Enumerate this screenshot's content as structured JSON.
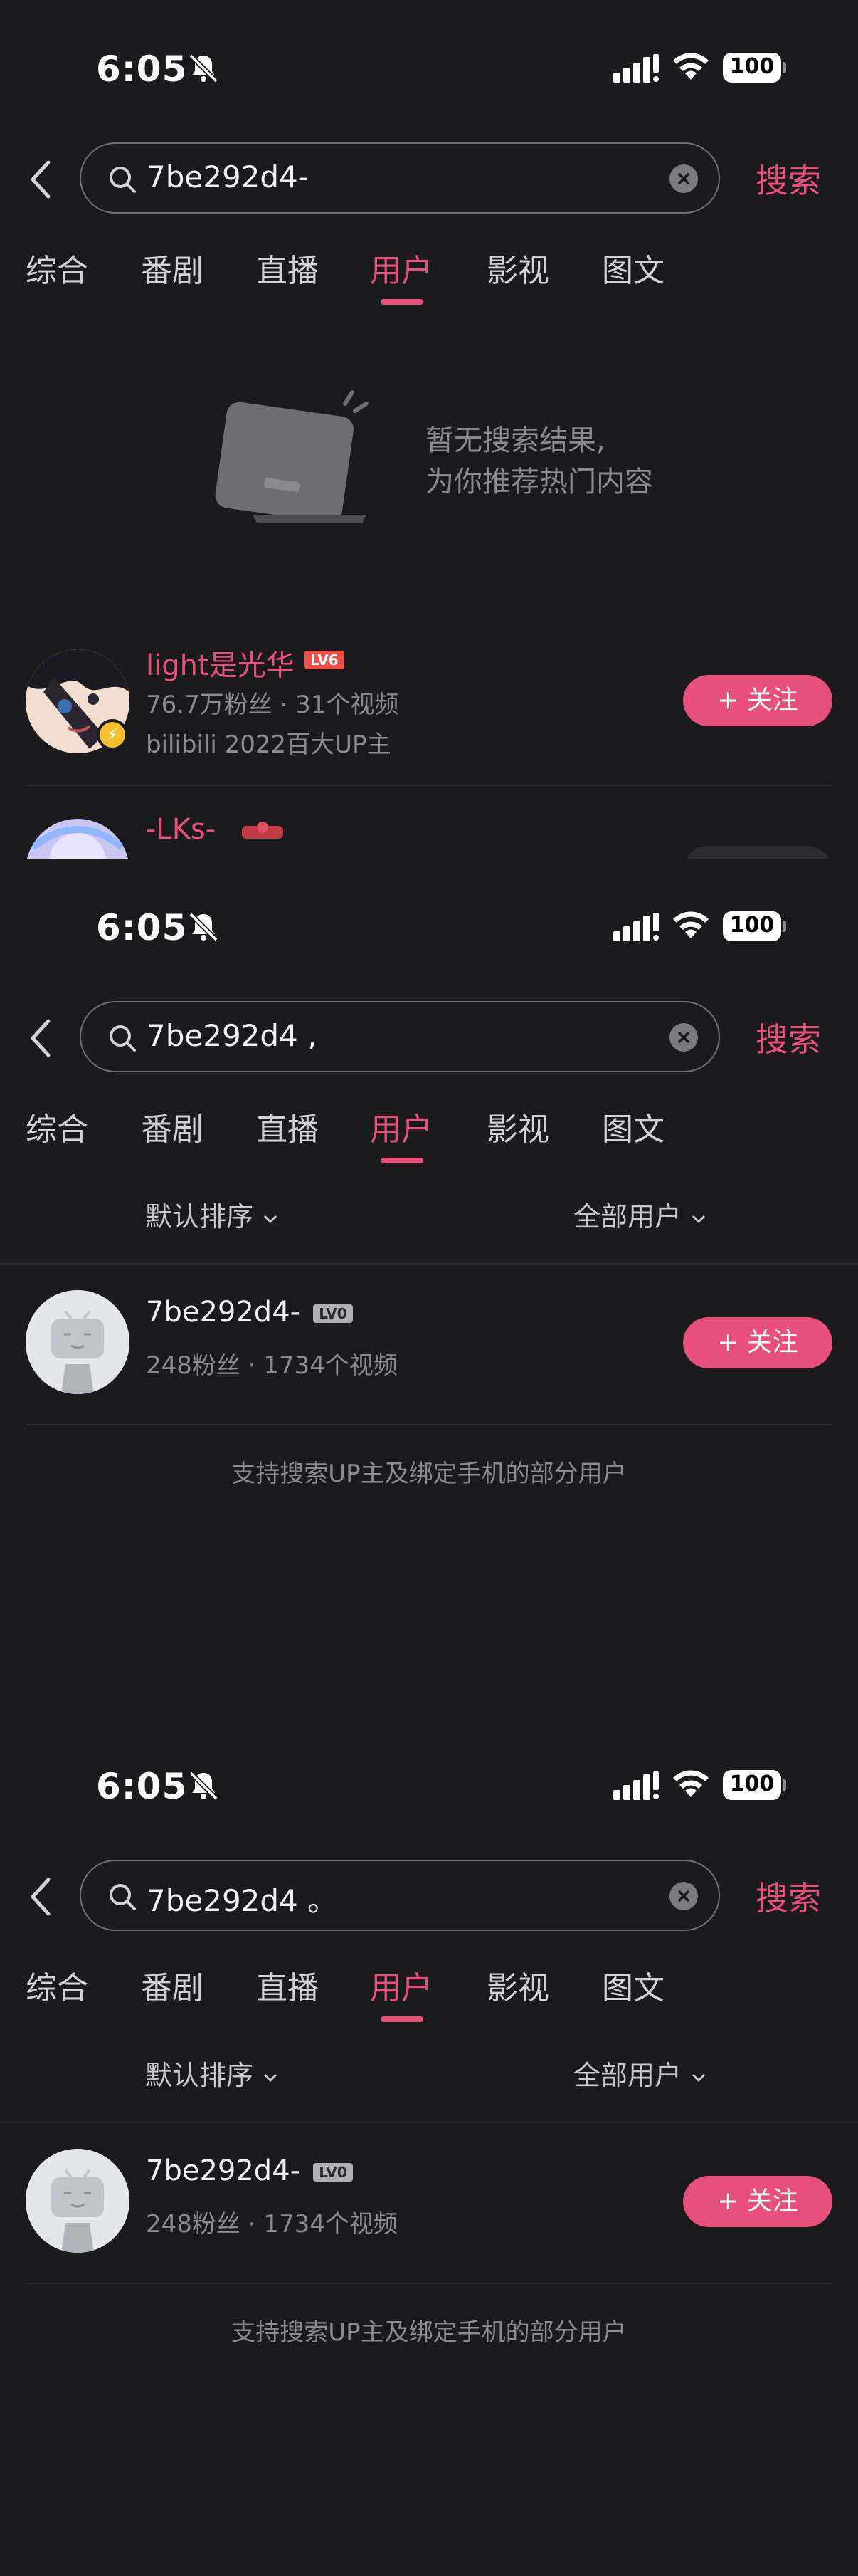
{
  "status_bar": {
    "time": "6:05",
    "battery": "100"
  },
  "search": {
    "button_label": "搜索"
  },
  "tabs": [
    "综合",
    "番剧",
    "直播",
    "用户",
    "影视",
    "图文"
  ],
  "active_tab": "用户",
  "panels": [
    {
      "query": "7be292d4-",
      "empty_state": {
        "line1": "暂无搜索结果,",
        "line2": "为你推荐热门内容"
      },
      "recommended_users": [
        {
          "name": "light是光华",
          "level": "LV6",
          "stats": "76.7万粉丝 · 31个视频",
          "description": "bilibili 2022百大UP主",
          "follow_label": "+ 关注"
        },
        {
          "name": "-LKs-"
        }
      ]
    },
    {
      "query": "7be292d4 ,",
      "sort_label": "默认排序",
      "filter_label": "全部用户",
      "result": {
        "name": "7be292d4-",
        "level": "LV0",
        "stats": "248粉丝 · 1734个视频",
        "follow_label": "+ 关注"
      },
      "footer_note": "支持搜索UP主及绑定手机的部分用户"
    },
    {
      "query": "7be292d4 。",
      "sort_label": "默认排序",
      "filter_label": "全部用户",
      "result": {
        "name": "7be292d4-",
        "level": "LV0",
        "stats": "248粉丝 · 1734个视频",
        "follow_label": "+ 关注"
      },
      "footer_note": "支持搜索UP主及绑定手机的部分用户"
    }
  ],
  "colors": {
    "accent": "#e8507c",
    "background": "#1b1b1d",
    "secondary_text": "#8a8a90"
  }
}
